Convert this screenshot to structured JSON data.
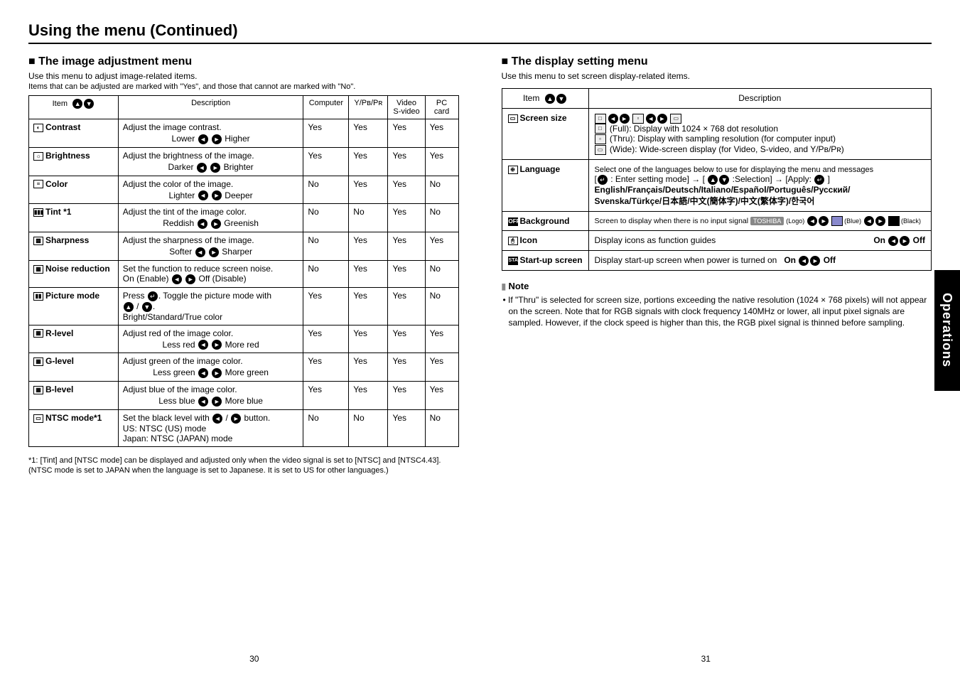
{
  "page_title": "Using the menu (Continued)",
  "side_tab": "Operations",
  "page_num_left": "30",
  "page_num_right": "31",
  "left_section": {
    "heading": "The image adjustment menu",
    "sub1": "Use this menu to adjust image-related items.",
    "sub2": "Items that can be adjusted are marked with  \"Yes\", and those that cannot are marked with \"No\".",
    "headers": {
      "item": "Item",
      "description": "Description",
      "computer": "Computer",
      "ypbpr": "Y/Pʙ/Pʀ",
      "video": "Video S-video",
      "pc_card": "PC card"
    },
    "rows": [
      {
        "item": "Contrast",
        "desc_main": "Adjust the image contrast.",
        "desc_left": "Lower",
        "desc_right": "Higher",
        "v": [
          "Yes",
          "Yes",
          "Yes",
          "Yes"
        ]
      },
      {
        "item": "Brightness",
        "desc_main": "Adjust the brightness of the image.",
        "desc_left": "Darker",
        "desc_right": "Brighter",
        "v": [
          "Yes",
          "Yes",
          "Yes",
          "Yes"
        ]
      },
      {
        "item": "Color",
        "desc_main": "Adjust the color of the image.",
        "desc_left": "Lighter",
        "desc_right": "Deeper",
        "v": [
          "No",
          "Yes",
          "Yes",
          "No"
        ]
      },
      {
        "item": "Tint *1",
        "desc_main": "Adjust the tint of the image color.",
        "desc_left": "Reddish",
        "desc_right": "Greenish",
        "v": [
          "No",
          "No",
          "Yes",
          "No"
        ]
      },
      {
        "item": "Sharpness",
        "desc_main": "Adjust the sharpness of the image.",
        "desc_left": "Softer",
        "desc_right": "Sharper",
        "v": [
          "No",
          "Yes",
          "Yes",
          "Yes"
        ]
      },
      {
        "item": "Noise reduction",
        "desc_main": "Set the function to reduce screen noise.",
        "desc_left": "On (Enable)",
        "desc_right": "Off (Disable)",
        "v": [
          "No",
          "Yes",
          "Yes",
          "No"
        ]
      },
      {
        "item": "Picture mode",
        "desc_pm_1": "Press ",
        "desc_pm_2": ". Toggle the picture mode with",
        "desc_pm_3": " / ",
        "desc_pm_4": ".",
        "desc_pm_5": "Bright/Standard/True color",
        "v": [
          "Yes",
          "Yes",
          "Yes",
          "No"
        ]
      },
      {
        "item": "R-level",
        "desc_main": "Adjust red of the image color.",
        "desc_left": "Less red",
        "desc_right": "More red",
        "v": [
          "Yes",
          "Yes",
          "Yes",
          "Yes"
        ]
      },
      {
        "item": "G-level",
        "desc_main": "Adjust green of the image color.",
        "desc_left": "Less green",
        "desc_right": "More green",
        "v": [
          "Yes",
          "Yes",
          "Yes",
          "Yes"
        ]
      },
      {
        "item": "B-level",
        "desc_main": "Adjust blue of the image color.",
        "desc_left": "Less blue",
        "desc_right": "More blue",
        "v": [
          "Yes",
          "Yes",
          "Yes",
          "Yes"
        ]
      },
      {
        "item": "NTSC mode*1",
        "desc_ntsc_1": "Set the black level with ",
        "desc_ntsc_2": " / ",
        "desc_ntsc_3": " button.",
        "desc_ntsc_4": "US:      NTSC (US) mode",
        "desc_ntsc_5": "Japan:  NTSC (JAPAN) mode",
        "v": [
          "No",
          "No",
          "Yes",
          "No"
        ]
      }
    ],
    "footnote": "*1: [Tint] and [NTSC mode] can be displayed and adjusted only when the video signal is set to [NTSC] and [NTSC4.43]. (NTSC mode is set to JAPAN when the language is set to Japanese. It is set to US for other languages.)"
  },
  "right_section": {
    "heading": "The display setting menu",
    "sub1": "Use this menu to set screen display-related items.",
    "headers": {
      "item": "Item",
      "description": "Description"
    },
    "screen_size": {
      "label": "Screen size",
      "full": "(Full):  Display with 1024 × 768 dot resolution",
      "thru": "(Thru): Display with sampling resolution (for computer input)",
      "wide": "(Wide): Wide-screen display (for Video, S-video, and Y/Pʙ/Pʀ)"
    },
    "language": {
      "label": "Language",
      "line1": "Select one of the languages below to use for displaying the menu and messages",
      "line2a": "[",
      "line2b": " : Enter setting mode] → [ ",
      "line2c": " :Selection] → [Apply: ",
      "line2d": " ]",
      "line3": "English/Français/Deutsch/Italiano/Español/Português/Русский/",
      "line4": "Svenska/Türkçe/日本語/中文(簡体字)/中文(繁体字)/한국어"
    },
    "background": {
      "label": "Background",
      "text1": "Screen to display when there is no input signal ",
      "logo": "TOSHIBA",
      "logo_label": "(Logo)",
      "blue_label": "(Blue)",
      "black_label": "(Black)"
    },
    "icon_row": {
      "label": "Icon",
      "desc": "Display icons as function guides",
      "on": "On",
      "off": "Off"
    },
    "startup_row": {
      "label": "Start-up screen",
      "desc": "Display start-up screen when power is turned on",
      "on": "On",
      "off": "Off"
    },
    "note_heading": "Note",
    "note_body": "• If \"Thru\" is selected for screen size, portions exceeding the native resolution (1024 × 768 pixels) will not appear on the screen. Note that for RGB signals with clock frequency 140MHz or lower, all input pixel signals are sampled. However, if the clock speed is higher than this, the RGB pixel signal is thinned before sampling."
  }
}
